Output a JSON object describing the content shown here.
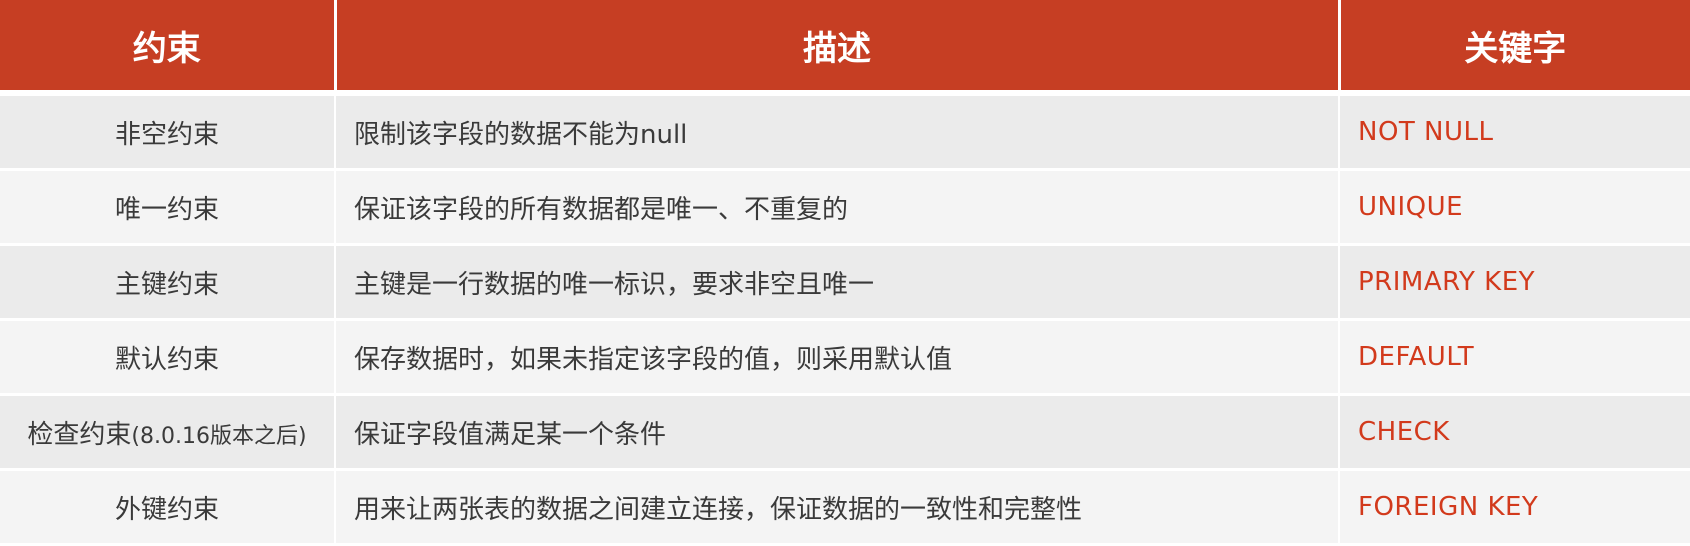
{
  "table": {
    "headers": [
      "约束",
      "描述",
      "关键字"
    ],
    "rows": [
      {
        "name": "非空约束",
        "note": "",
        "desc": "限制该字段的数据不能为null",
        "keyword": "NOT  NULL"
      },
      {
        "name": "唯一约束",
        "note": "",
        "desc": "保证该字段的所有数据都是唯一、不重复的",
        "keyword": "UNIQUE"
      },
      {
        "name": "主键约束",
        "note": "",
        "desc": "主键是一行数据的唯一标识，要求非空且唯一",
        "keyword": "PRIMARY  KEY"
      },
      {
        "name": "默认约束",
        "note": "",
        "desc": "保存数据时，如果未指定该字段的值，则采用默认值",
        "keyword": "DEFAULT"
      },
      {
        "name": "检查约束",
        "note": "(8.0.16版本之后)",
        "desc": "保证字段值满足某一个条件",
        "keyword": "CHECK"
      },
      {
        "name": "外键约束",
        "note": "",
        "desc": "用来让两张表的数据之间建立连接，保证数据的一致性和完整性",
        "keyword": "FOREIGN  KEY"
      }
    ]
  },
  "colors": {
    "header_bg": "#c63e23",
    "keyword_text": "#d23a1c"
  }
}
